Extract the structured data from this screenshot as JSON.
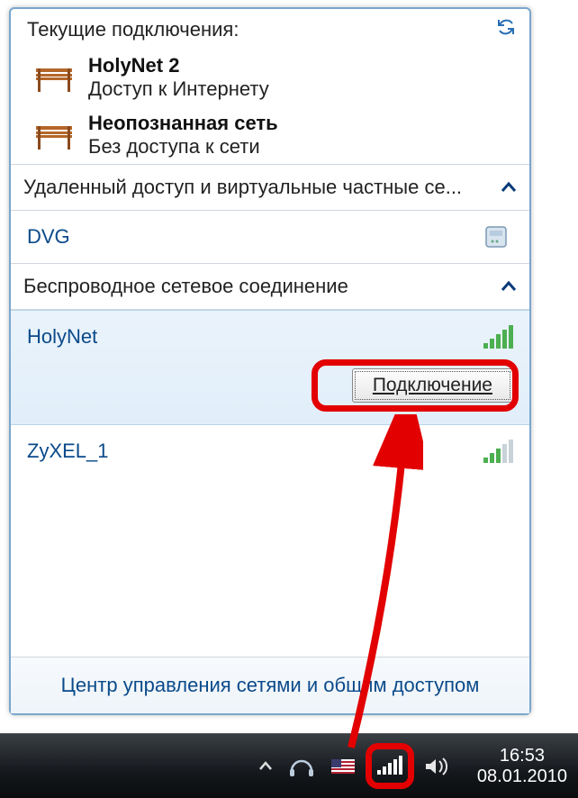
{
  "header": {
    "title": "Текущие подключения:"
  },
  "current_connections": [
    {
      "name": "HolyNet  2",
      "status": "Доступ к Интернету"
    },
    {
      "name": "Неопознанная сеть",
      "status": "Без доступа к сети"
    }
  ],
  "sections": {
    "vpn": {
      "label": "Удаленный доступ и виртуальные частные се..."
    },
    "wireless": {
      "label": "Беспроводное сетевое соединение"
    }
  },
  "vpn_items": [
    {
      "name": "DVG"
    }
  ],
  "wifi_items": [
    {
      "name": "HolyNet",
      "signal": 5,
      "selected": true
    },
    {
      "name": "ZyXEL_1",
      "signal": 3,
      "selected": false
    }
  ],
  "buttons": {
    "connect": "Подключение"
  },
  "footer": {
    "label": "Центр управления сетями и общим доступом"
  },
  "clock": {
    "time": "16:53",
    "date": "08.01.2010"
  }
}
